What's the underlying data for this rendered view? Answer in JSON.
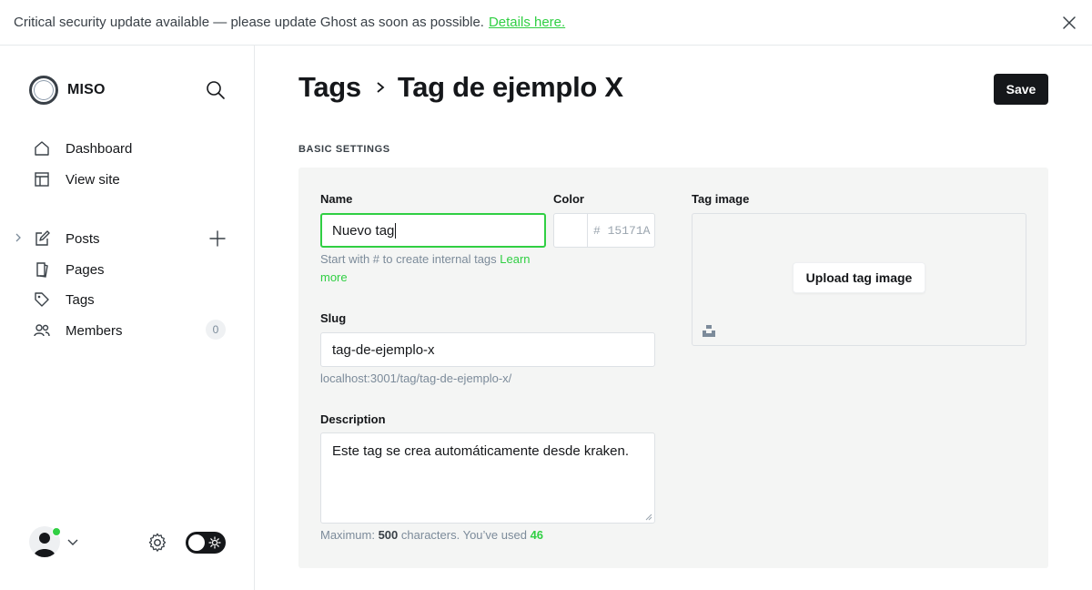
{
  "banner": {
    "message": "Critical security update available — please update Ghost as soon as possible.",
    "link": "Details here."
  },
  "sidebar": {
    "site_name": "MISO",
    "nav": [
      {
        "label": "Dashboard",
        "icon": "home-icon"
      },
      {
        "label": "View site",
        "icon": "layout-icon"
      }
    ],
    "content": [
      {
        "label": "Posts",
        "icon": "pen-icon"
      },
      {
        "label": "Pages",
        "icon": "page-icon"
      },
      {
        "label": "Tags",
        "icon": "tag-icon"
      },
      {
        "label": "Members",
        "icon": "members-icon",
        "badge": "0"
      }
    ]
  },
  "header": {
    "breadcrumb_parent": "Tags",
    "title": "Tag de ejemplo X",
    "save_label": "Save"
  },
  "form": {
    "section_title": "BASIC SETTINGS",
    "name_label": "Name",
    "name_value": "Nuevo tag",
    "name_hint": "Start with # to create internal tags",
    "name_hint_link": "Learn more",
    "color_label": "Color",
    "color_hash": "#",
    "color_placeholder": "15171A",
    "slug_label": "Slug",
    "slug_value": "tag-de-ejemplo-x",
    "slug_url": "localhost:3001/tag/tag-de-ejemplo-x/",
    "description_label": "Description",
    "description_value": "Este tag se crea automáticamente desde kraken.",
    "desc_hint_prefix": "Maximum:",
    "desc_max": "500",
    "desc_hint_mid": "characters. You’ve used",
    "desc_used": "46",
    "image_label": "Tag image",
    "upload_label": "Upload tag image"
  },
  "colors": {
    "accent": "#30cf43",
    "dark": "#15171a",
    "panel": "#f4f5f4"
  }
}
